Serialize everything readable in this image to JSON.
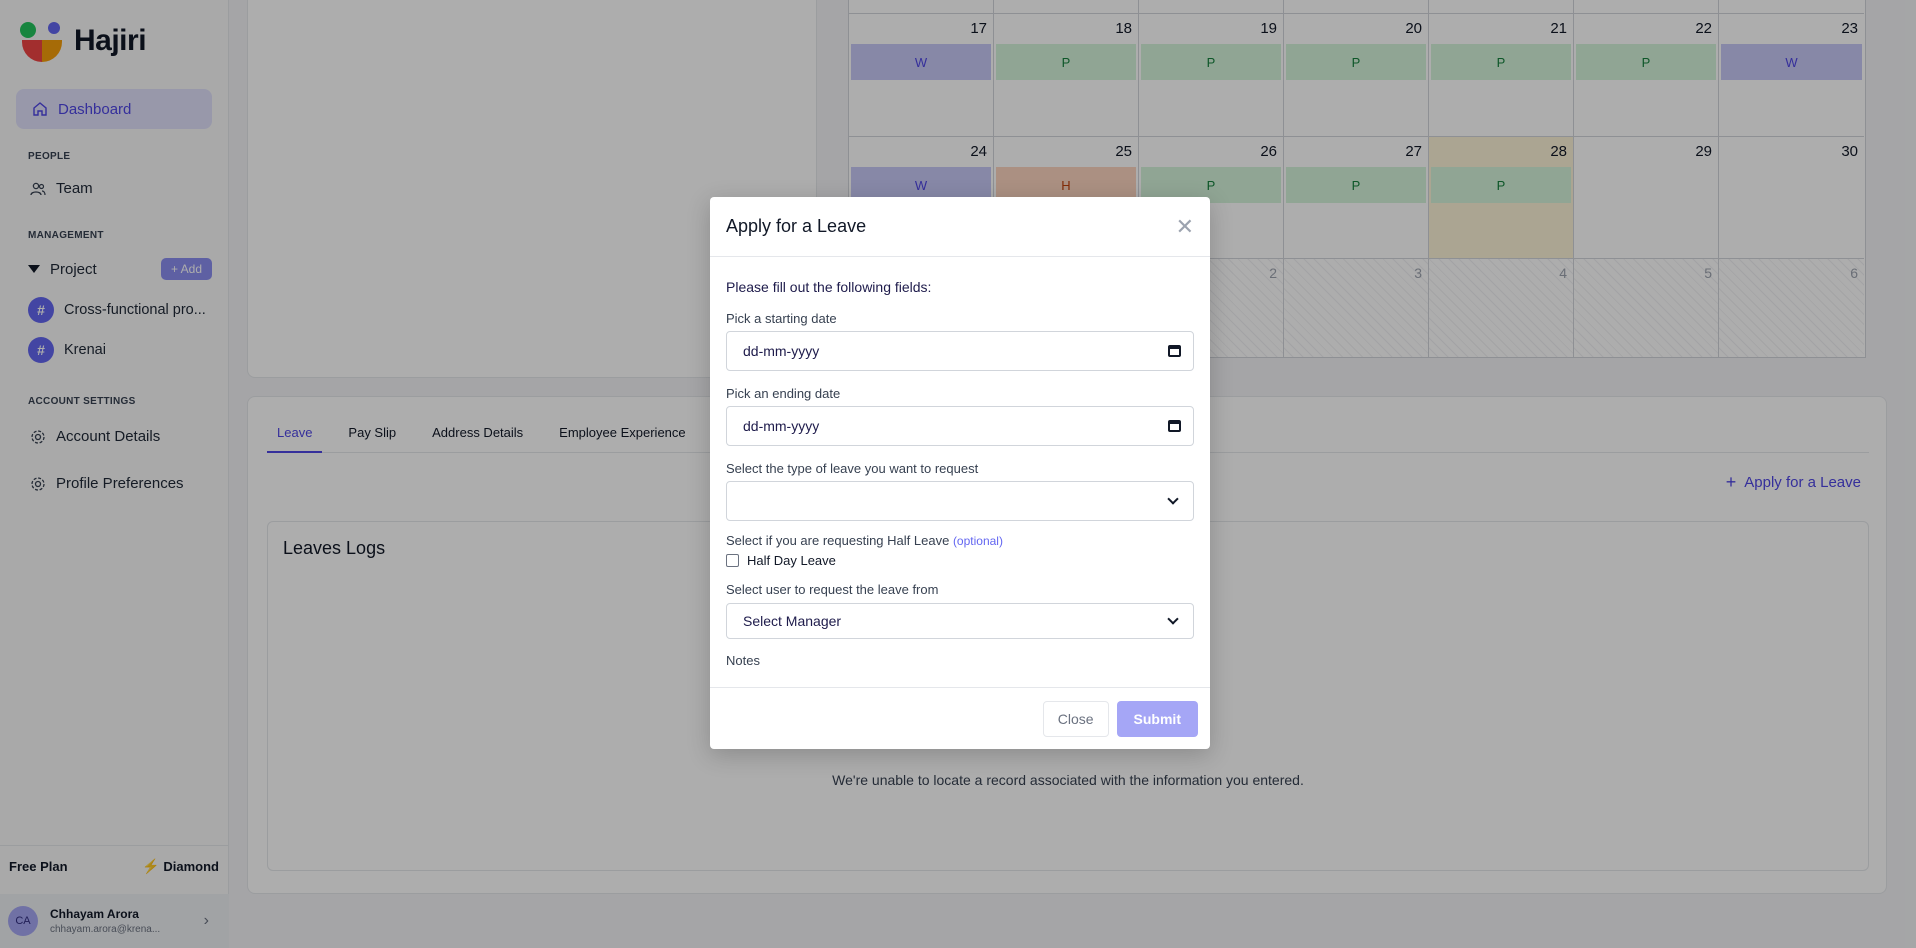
{
  "app": {
    "name": "Hajiri"
  },
  "sidebar": {
    "dashboard_label": "Dashboard",
    "people_section": "PEOPLE",
    "team_label": "Team",
    "management_section": "MANAGEMENT",
    "project_label": "Project",
    "add_label": "+ Add",
    "projects": [
      {
        "label": "Cross-functional pro..."
      },
      {
        "label": "Krenai"
      }
    ],
    "account_section": "ACCOUNT SETTINGS",
    "account_details_label": "Account Details",
    "profile_preferences_label": "Profile Preferences",
    "plan_name": "Free Plan",
    "plan_tier": "Diamond",
    "user": {
      "initials": "CA",
      "name": "Chhayam Arora",
      "email": "chhayam.arora@krena..."
    }
  },
  "calendar": {
    "weeks": [
      [
        {
          "day": "17",
          "status": "W"
        },
        {
          "day": "18",
          "status": "P"
        },
        {
          "day": "19",
          "status": "P"
        },
        {
          "day": "20",
          "status": "P"
        },
        {
          "day": "21",
          "status": "P"
        },
        {
          "day": "22",
          "status": "P"
        },
        {
          "day": "23",
          "status": "W"
        }
      ],
      [
        {
          "day": "24",
          "status": "W"
        },
        {
          "day": "25",
          "status": "H"
        },
        {
          "day": "26",
          "status": "P"
        },
        {
          "day": "27",
          "status": "P"
        },
        {
          "day": "28",
          "status": "P"
        },
        {
          "day": "29",
          "status": ""
        },
        {
          "day": "30",
          "status": ""
        }
      ],
      [
        {
          "day": "",
          "status": ""
        },
        {
          "day": "",
          "status": ""
        },
        {
          "day": "2",
          "status": ""
        },
        {
          "day": "3",
          "status": ""
        },
        {
          "day": "4",
          "status": ""
        },
        {
          "day": "5",
          "status": ""
        },
        {
          "day": "6",
          "status": ""
        }
      ]
    ],
    "colors": {
      "W": "#c7c9f7",
      "P": "#d4f4db",
      "H": "#fcd5c0",
      "today": "#fdf3d7"
    }
  },
  "tabs": [
    {
      "label": "Leave"
    },
    {
      "label": "Pay Slip"
    },
    {
      "label": "Address Details"
    },
    {
      "label": "Employee Experience"
    }
  ],
  "apply_link_label": "Apply for a Leave",
  "logs": {
    "title": "Leaves Logs",
    "empty_message": "We're unable to locate a record associated with the information you entered."
  },
  "modal": {
    "title": "Apply for a Leave",
    "intro": "Please fill out the following fields:",
    "start_label": "Pick a starting date",
    "start_value": "dd-mm-yyyy",
    "end_label": "Pick an ending date",
    "end_value": "dd-mm-yyyy",
    "type_label": "Select the type of leave you want to request",
    "type_value": "",
    "half_label": "Select if you are requesting Half Leave",
    "half_optional": "(optional)",
    "half_checkbox_label": "Half Day Leave",
    "manager_label": "Select user to request the leave from",
    "manager_value": "Select Manager",
    "notes_label": "Notes",
    "close_label": "Close",
    "submit_label": "Submit"
  },
  "theme": {
    "accent": "#4f46e5",
    "submit": "#a5a6f6"
  }
}
